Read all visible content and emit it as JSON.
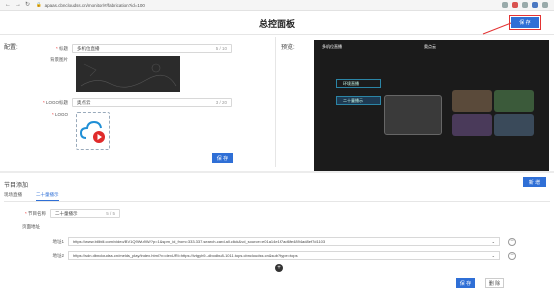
{
  "browser": {
    "url": "apaas.cbncloudss.cn/monitor/#/fabrication?id=100"
  },
  "header": {
    "title": "总控面板",
    "save_label": "保 存"
  },
  "config": {
    "label": "配置:",
    "title_field": {
      "label": "标题",
      "value": "多机位直播",
      "count": "5 / 10"
    },
    "bg_label": "背景图片",
    "logo_title_field": {
      "label": "LOGO标题",
      "value": "奥点云",
      "count": "3 / 20"
    },
    "logo_label": "LOGO",
    "save_label": "保 存"
  },
  "preview": {
    "label": "预览:",
    "screen_title": "多机位直播",
    "screen_logo_text": "奥点云",
    "menu": [
      "环境直播",
      "二十童播示"
    ]
  },
  "program": {
    "label": "节目添加",
    "new_label": "新 增",
    "tabs": [
      "现场直播",
      "二十童播示"
    ],
    "name_field": {
      "label": "节目名称",
      "value": "二十童播示",
      "count": "5 / 5"
    },
    "urls_label": "页面地址",
    "urls": [
      {
        "label": "地址1",
        "value": "https://www.bilibili.com/video/BV1Q9Wu9W/?p=1&spm_id_from=333.337.search-card.all.click&vd_source=e01a14e1f7ad6fe4894ad8ef7d1103"
      },
      {
        "label": "地址2",
        "value": "https://sdn.dbncloudss.cn/melds_play/index.html?v=dexURl=https://ivtgyh9--dbodbu8-1011.tops.cbncloudss.cn&sub?type=tops"
      }
    ],
    "save_label": "保 存",
    "delete_label": "删 除"
  },
  "colors": {
    "primary": "#2f6fd6",
    "annotation": "#e33333"
  }
}
